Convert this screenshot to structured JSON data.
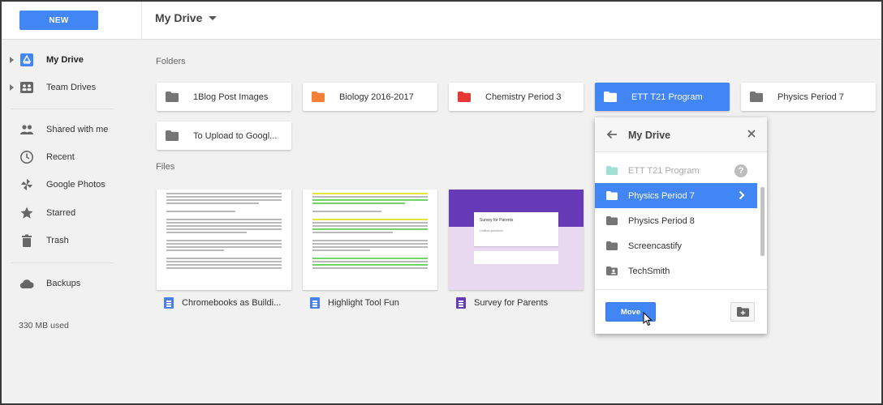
{
  "header": {
    "new_label": "NEW",
    "title": "My Drive"
  },
  "sidebar": {
    "items": [
      {
        "label": "My Drive",
        "icon": "my-drive-icon"
      },
      {
        "label": "Team Drives",
        "icon": "team-drives-icon"
      },
      {
        "label": "Shared with me",
        "icon": "people-icon"
      },
      {
        "label": "Recent",
        "icon": "clock-icon"
      },
      {
        "label": "Google Photos",
        "icon": "pinwheel-icon"
      },
      {
        "label": "Starred",
        "icon": "star-icon"
      },
      {
        "label": "Trash",
        "icon": "trash-icon"
      },
      {
        "label": "Backups",
        "icon": "cloud-icon"
      }
    ],
    "storage": "330 MB used"
  },
  "content": {
    "folders_label": "Folders",
    "files_label": "Files",
    "folders": [
      {
        "name": "1Blog Post Images",
        "color": "#757575"
      },
      {
        "name": "Biology 2016-2017",
        "color": "#f6803a"
      },
      {
        "name": "Chemistry Period 3",
        "color": "#e53935"
      },
      {
        "name": "ETT T21 Program",
        "color": "#ffffff",
        "selected": true
      },
      {
        "name": "Physics Period 7",
        "color": "#757575"
      },
      {
        "name": "To Upload to Googl...",
        "color": "#757575"
      }
    ],
    "files": [
      {
        "name": "Chromebooks as Buildi...",
        "type": "doc",
        "icon_color": "#4a7ff0"
      },
      {
        "name": "Highlight Tool Fun",
        "type": "doc",
        "icon_color": "#4a7ff0"
      },
      {
        "name": "Survey for Parents",
        "type": "form",
        "icon_color": "#673ab7"
      }
    ],
    "form_preview": {
      "title": "Survey for Parents",
      "subtitle": "Untitled questions",
      "header_color": "#673ab7"
    }
  },
  "move_dialog": {
    "title": "My Drive",
    "rows": [
      {
        "label": "ETT T21 Program",
        "state": "disabled",
        "icon_color": "#9fe0d4"
      },
      {
        "label": "Physics Period 7",
        "state": "selected",
        "icon_color": "#ffffff"
      },
      {
        "label": "Physics Period 8",
        "state": "normal",
        "icon_color": "#757575"
      },
      {
        "label": "Screencastify",
        "state": "normal",
        "icon_color": "#757575"
      },
      {
        "label": "TechSmith",
        "state": "normal",
        "icon_color": "#757575"
      }
    ],
    "help_glyph": "?",
    "move_label": "Move"
  }
}
